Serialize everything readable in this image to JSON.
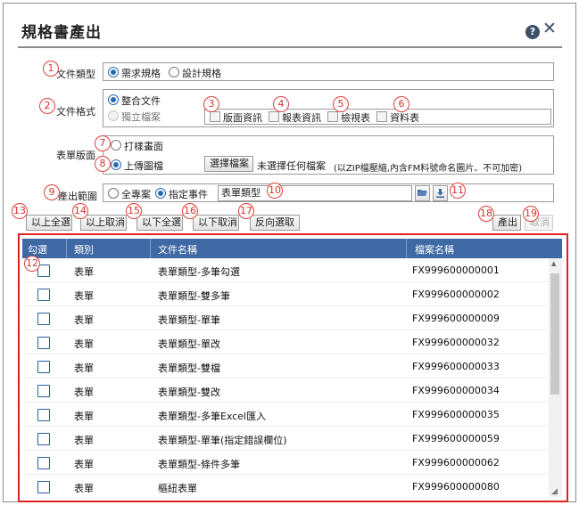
{
  "dialog": {
    "title": "規格書產出",
    "help_glyph": "?",
    "close_glyph": "✕"
  },
  "badges": [
    "1",
    "2",
    "3",
    "4",
    "5",
    "6",
    "7",
    "8",
    "9",
    "10",
    "11",
    "12",
    "13",
    "14",
    "15",
    "16",
    "17",
    "18",
    "19"
  ],
  "doc_type": {
    "label": "文件類型",
    "options": [
      "需求規格",
      "設計規格"
    ],
    "selected": "需求規格"
  },
  "doc_format": {
    "label": "文件格式",
    "options": [
      "整合文件",
      "獨立檔案"
    ],
    "selected": "整合文件",
    "checkboxes": [
      "版面資訊",
      "報表資訊",
      "檢視表",
      "資料表"
    ]
  },
  "form_layout": {
    "label": "表單版面",
    "options": [
      "打樣畫面",
      "上傳圖檔"
    ],
    "selected": "上傳圖檔",
    "choose_file_button": "選擇檔案",
    "no_file_text": "未選擇任何檔案",
    "hint": "(以ZIP檔壓縮,內含FM料號命名圖片、不可加密)"
  },
  "output_scope": {
    "label": "產出範圍",
    "options": [
      "全專案",
      "指定事件"
    ],
    "selected": "指定事件",
    "input_value": "表單類型",
    "folder_icon": "folder-open-icon",
    "download_icon": "download-icon"
  },
  "toolbar": {
    "select_above": "以上全選",
    "cancel_above": "以上取消",
    "select_below": "以下全選",
    "cancel_below": "以下取消",
    "invert": "反向選取",
    "export": "產出",
    "cancel": "取消"
  },
  "grid": {
    "headers": [
      "勾選",
      "類別",
      "文件名稱",
      "檔案名稱"
    ],
    "header_color": "#3f69a5",
    "rows": [
      {
        "category": "表單",
        "doc_name": "表單類型-多筆勾選",
        "file_name": "FX999600000001"
      },
      {
        "category": "表單",
        "doc_name": "表單類型-雙多筆",
        "file_name": "FX999600000002"
      },
      {
        "category": "表單",
        "doc_name": "表單類型-單筆",
        "file_name": "FX999600000009"
      },
      {
        "category": "表單",
        "doc_name": "表單類型-單改",
        "file_name": "FX999600000032"
      },
      {
        "category": "表單",
        "doc_name": "表單類型-雙檔",
        "file_name": "FX999600000033"
      },
      {
        "category": "表單",
        "doc_name": "表單類型-雙改",
        "file_name": "FX999600000034"
      },
      {
        "category": "表單",
        "doc_name": "表單類型-多筆Excel匯入",
        "file_name": "FX999600000035"
      },
      {
        "category": "表單",
        "doc_name": "表單類型-單筆(指定錯誤欄位)",
        "file_name": "FX999600000059"
      },
      {
        "category": "表單",
        "doc_name": "表單類型-條件多筆",
        "file_name": "FX999600000062"
      },
      {
        "category": "表單",
        "doc_name": "樞紐表單",
        "file_name": "FX999600000080"
      }
    ]
  },
  "colors": {
    "accent": "#2a6ab5",
    "badge": "#e0403a",
    "highlight_frame": "#e02020"
  }
}
